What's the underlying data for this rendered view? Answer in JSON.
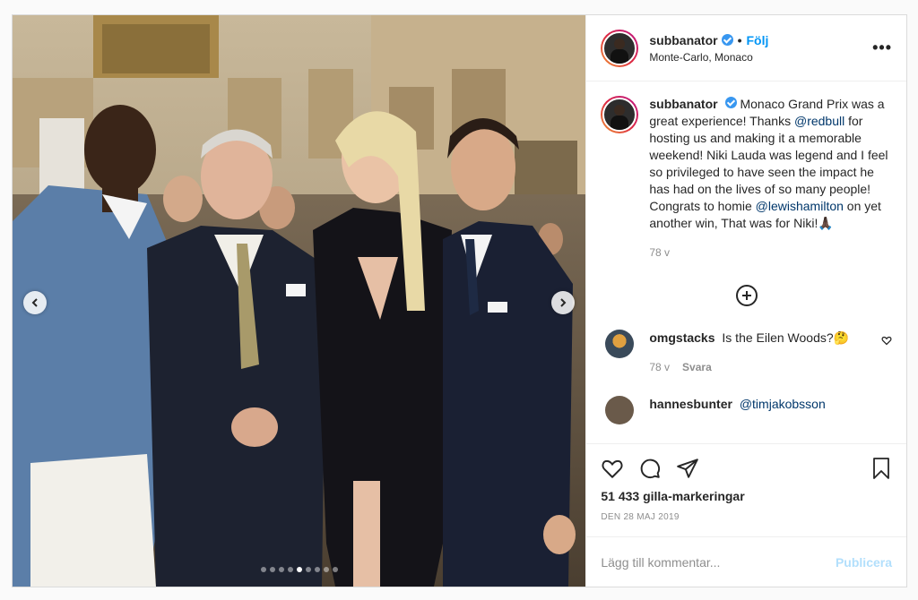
{
  "post": {
    "username": "subbanator",
    "follow_label": "Följ",
    "separator": "•",
    "location": "Monte-Carlo, Monaco",
    "more_icon": "more-horizontal-icon"
  },
  "caption": {
    "username": "subbanator",
    "text_1": "Monaco Grand Prix was a great experience! Thanks ",
    "mention_1": "@redbull",
    "text_2": " for hosting us and making it a memorable weekend! Niki Lauda was legend and I feel so privileged to have seen the impact he has had on the lives of so many people! Congrats to homie ",
    "mention_2": "@lewishamilton",
    "text_3": " on yet another win, That was for Niki!🙏🏿",
    "age": "78 v"
  },
  "comments": [
    {
      "username": "omgstacks",
      "text": "Is the Eilen Woods?🤔",
      "age": "78 v",
      "reply_label": "Svara"
    },
    {
      "username": "hannesbunter",
      "text": "@timjakobsson"
    }
  ],
  "actions": {
    "likes": "51 433 gilla-markeringar",
    "date": "DEN 28 MAJ 2019",
    "comment_placeholder": "Lägg till kommentar...",
    "publish_label": "Publicera"
  },
  "carousel": {
    "total": 9,
    "active_index": 4
  },
  "colors": {
    "accent": "#0095f6",
    "verified": "#3897f0",
    "publish_disabled": "#b2dffc"
  }
}
